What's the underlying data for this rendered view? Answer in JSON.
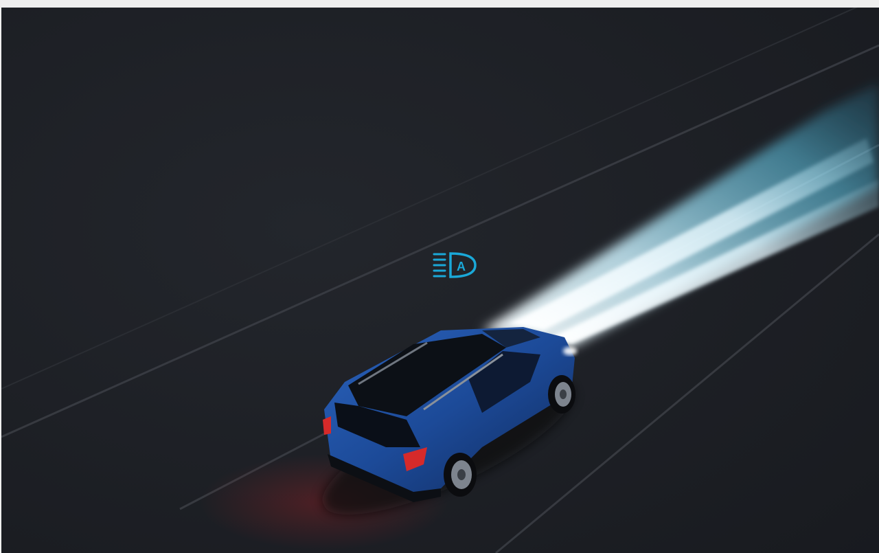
{
  "scene": {
    "subject": "blue-suv-driving-at-night",
    "indicator_icon": "auto-high-beam-icon",
    "indicator_letter": "A",
    "colors": {
      "background": "#1d1f24",
      "road_line": "#3a3d44",
      "beam": "#9fdcf0",
      "beam_core": "#ffffff",
      "indicator": "#1aa8d8",
      "car_body": "#1f4f9e",
      "car_roof": "#0c1016",
      "tail_light": "#d62a2a"
    }
  }
}
